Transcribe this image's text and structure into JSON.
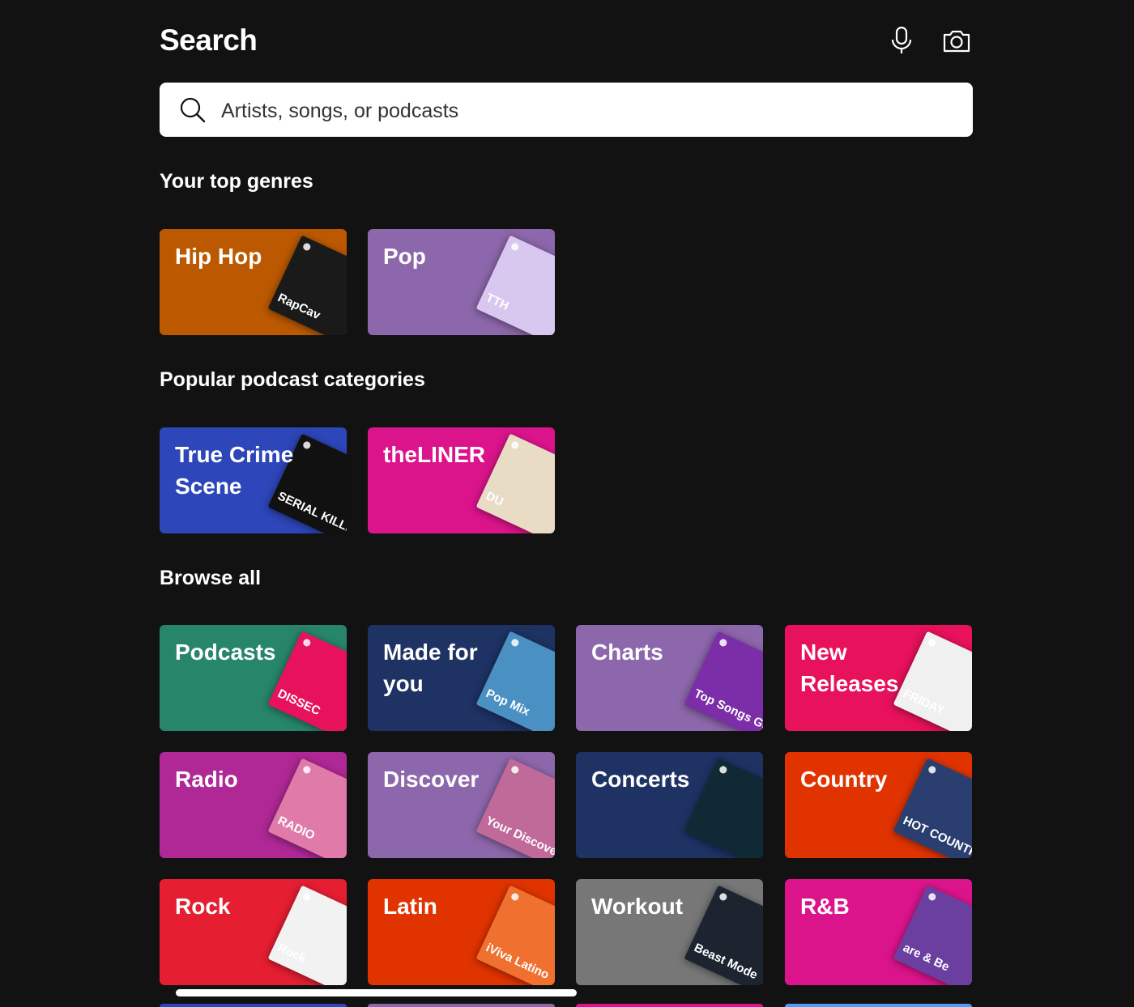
{
  "header": {
    "title": "Search",
    "mic_icon": "microphone-icon",
    "camera_icon": "camera-icon"
  },
  "search": {
    "placeholder": "Artists, songs, or podcasts",
    "value": "",
    "icon": "search-icon"
  },
  "sections": {
    "top_genres": {
      "title": "Your top genres",
      "cards": [
        {
          "label": "Hip Hop",
          "color": "#BC5900",
          "art_color": "#1a1a1a",
          "art_text": "RapCav"
        },
        {
          "label": "Pop",
          "color": "#8D67AB",
          "art_color": "#d8c8f0",
          "art_text": "TTH"
        }
      ]
    },
    "podcast_categories": {
      "title": "Popular podcast categories",
      "cards": [
        {
          "label": "True Crime Scene",
          "color": "#2D46B9",
          "art_color": "#111111",
          "art_text": "SERIAL KILLER"
        },
        {
          "label": "theLINER",
          "color": "#DC148C",
          "art_color": "#e8dcc4",
          "art_text": "DU"
        }
      ]
    },
    "browse_all": {
      "title": "Browse all",
      "cards": [
        {
          "label": "Podcasts",
          "color": "#27856A",
          "art_color": "#e8115b",
          "art_text": "DISSEC"
        },
        {
          "label": "Made for you",
          "color": "#1E3264",
          "art_color": "#4a90c2",
          "art_text": "Pop Mix"
        },
        {
          "label": "Charts",
          "color": "#8D67AB",
          "art_color": "#7b2ea8",
          "art_text": "Top Songs Global"
        },
        {
          "label": "New Releases",
          "color": "#E8115B",
          "art_color": "#f0f0f0",
          "art_text": "FRIDAY"
        },
        {
          "label": "Radio",
          "color": "#AF2896",
          "art_color": "#e07aa8",
          "art_text": "RADIO"
        },
        {
          "label": "Discover",
          "color": "#8D67AB",
          "art_color": "#c06a9a",
          "art_text": "Your Discover Weekly"
        },
        {
          "label": "Concerts",
          "color": "#1E3264",
          "art_color": "#0f2a35",
          "art_text": ""
        },
        {
          "label": "Country",
          "color": "#E13300",
          "art_color": "#2a3f70",
          "art_text": "HOT COUNTRY"
        },
        {
          "label": "Rock",
          "color": "#E61E32",
          "art_color": "#f2f2f2",
          "art_text": "Rock"
        },
        {
          "label": "Latin",
          "color": "#E13300",
          "art_color": "#f07030",
          "art_text": "iViva Latino"
        },
        {
          "label": "Workout",
          "color": "#777777",
          "art_color": "#1c2430",
          "art_text": "Beast Mode"
        },
        {
          "label": "R&B",
          "color": "#DC148C",
          "art_color": "#6a3fa0",
          "art_text": "are & Be"
        }
      ]
    }
  },
  "bottom_peek_colors": [
    "#2D46B9",
    "#8D67AB",
    "#DC148C",
    "#509BF5"
  ]
}
